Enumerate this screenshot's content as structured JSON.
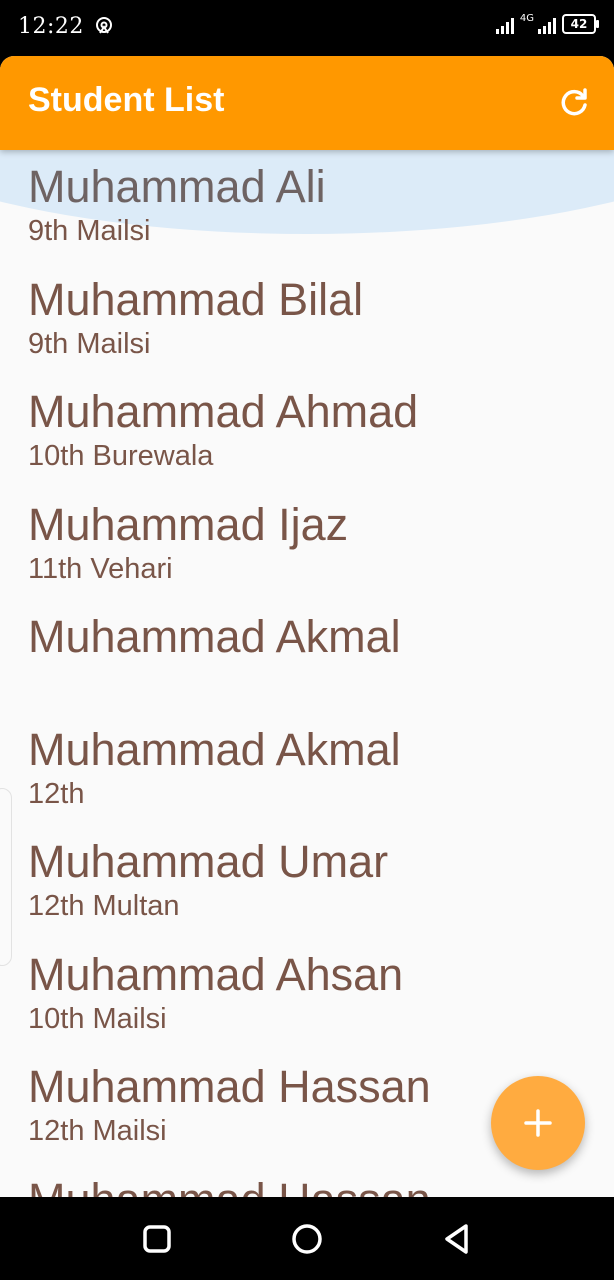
{
  "status_bar": {
    "time": "12:22",
    "network": "4G",
    "battery": "42",
    "icons": [
      "hotspot-icon",
      "signal-icon",
      "battery-icon"
    ]
  },
  "app_bar": {
    "title": "Student List",
    "refresh_icon": "refresh-icon",
    "background": "#ff9800"
  },
  "students": [
    {
      "name": "Muhammad Ali",
      "detail": "9th Mailsi"
    },
    {
      "name": "Muhammad Bilal",
      "detail": "9th Mailsi"
    },
    {
      "name": "Muhammad Ahmad",
      "detail": "10th Burewala"
    },
    {
      "name": "Muhammad Ijaz",
      "detail": "11th Vehari"
    },
    {
      "name": "Muhammad Akmal",
      "detail": ""
    },
    {
      "name": "Muhammad Akmal",
      "detail": "12th"
    },
    {
      "name": "Muhammad Umar",
      "detail": "12th Multan"
    },
    {
      "name": "Muhammad Ahsan",
      "detail": "10th Mailsi"
    },
    {
      "name": "Muhammad Hassan",
      "detail": "12th Mailsi"
    },
    {
      "name": "Muhammad Hassan",
      "detail": ""
    }
  ],
  "fab": {
    "icon": "plus-icon",
    "color": "#ffab40"
  },
  "nav_bar": {
    "icons": [
      "recent-apps-icon",
      "home-icon",
      "back-icon"
    ]
  },
  "colors": {
    "text": "#795548",
    "accent": "#ff9800"
  }
}
